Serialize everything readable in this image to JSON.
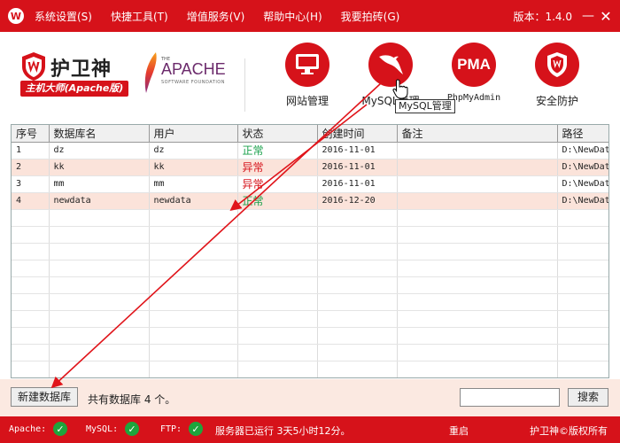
{
  "window": {
    "logo_letter": "W",
    "version": "版本：1.4.0",
    "minimize": "—",
    "close": "✕"
  },
  "menu": [
    {
      "label": "系统设置(S)"
    },
    {
      "label": "快捷工具(T)"
    },
    {
      "label": "增值服务(V)"
    },
    {
      "label": "帮助中心(H)"
    },
    {
      "label": "我要拍砖(G)"
    }
  ],
  "brand": {
    "name": "护卫神",
    "subtitle": "主机大师(Apache版)"
  },
  "apache_logo": {
    "the": "THE",
    "name": "APACHE",
    "foundation": "SOFTWARE FOUNDATION"
  },
  "tools": {
    "website": {
      "label": "网站管理",
      "icon": "monitor-icon"
    },
    "mysql": {
      "label": "MySQL管理",
      "icon": "dolphin-icon"
    },
    "phpmyadmin": {
      "label": "PhpMyAdmin",
      "icon_text": "PMA"
    },
    "security": {
      "label": "安全防护",
      "icon": "shield-icon"
    }
  },
  "tooltip": "MySQL管理",
  "table": {
    "headers": [
      "序号",
      "数据库名",
      "用户",
      "状态",
      "创建时间",
      "备注",
      "路径"
    ],
    "rows": [
      {
        "no": "1",
        "name": "dz",
        "user": "dz",
        "status": "正常",
        "created": "2016-11-01",
        "note": "",
        "path": "D:\\NewData"
      },
      {
        "no": "2",
        "name": "kk",
        "user": "kk",
        "status": "异常",
        "created": "2016-11-01",
        "note": "",
        "path": "D:\\NewData"
      },
      {
        "no": "3",
        "name": "mm",
        "user": "mm",
        "status": "异常",
        "created": "2016-11-01",
        "note": "",
        "path": "D:\\NewData"
      },
      {
        "no": "4",
        "name": "newdata",
        "user": "newdata",
        "status": "正常",
        "created": "2016-12-20",
        "note": "",
        "path": "D:\\NewData"
      }
    ]
  },
  "bottom": {
    "new_db_label": "新建数据库",
    "db_count": "共有数据库 4 个。",
    "search_value": "",
    "search_label": "搜索"
  },
  "status": {
    "apache": "Apache:",
    "mysql": "MySQL:",
    "ftp": "FTP:",
    "uptime": "服务器已运行 3天5小时12分。",
    "restart": "重启",
    "copyright": "护卫神©版权所有"
  },
  "colors": {
    "brand_red": "#d6121a",
    "ok_green": "#18a04a",
    "alt_row": "#fbe3da"
  }
}
